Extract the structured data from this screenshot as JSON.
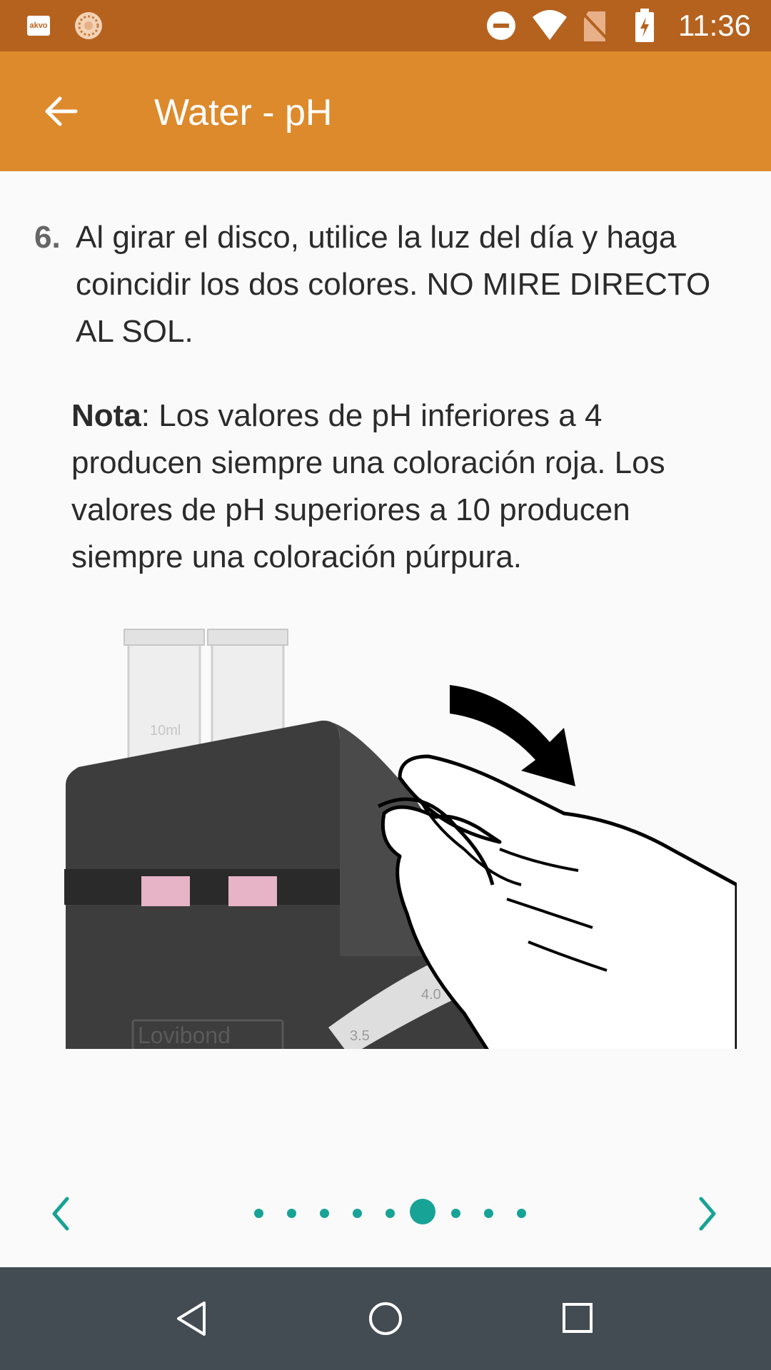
{
  "status_bar": {
    "app_badge": "akvo",
    "time": "11:36",
    "icons": [
      "akvo-notification-icon",
      "sync-icon",
      "do-not-disturb-icon",
      "wifi-icon",
      "no-sim-icon",
      "battery-charging-icon"
    ]
  },
  "app_bar": {
    "title": "Water - pH",
    "back_icon": "arrow-back-icon"
  },
  "instruction": {
    "number": "6.",
    "text": "Al girar el disco, utilice la luz del día y haga coincidir los dos colores. NO MIRE DIRECTO AL SOL.",
    "note_label": "Nota",
    "note_text": ": Los valores de pH inferiores a 4 producen siempre una coloración roja. Los valores de pH superiores a 10 producen siempre una coloración púrpura."
  },
  "illustration": {
    "brand_text": "Lovibond",
    "tube_label": "10ml",
    "scale_labels": [
      "3.5",
      "4.0"
    ]
  },
  "pager": {
    "prev_icon": "chevron-left-icon",
    "next_icon": "chevron-right-icon",
    "total_pages": 9,
    "current_page": 6,
    "accent_color": "#17a396"
  },
  "nav_bar": {
    "icons": [
      "nav-back-icon",
      "nav-home-icon",
      "nav-recents-icon"
    ]
  },
  "colors": {
    "status_bar": "#b5621f",
    "app_bar": "#dd8a2c",
    "nav_bar": "#434b53",
    "background": "#fafafa"
  }
}
